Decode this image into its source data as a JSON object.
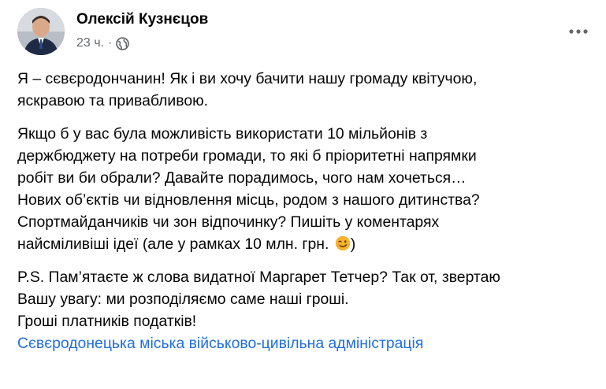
{
  "post": {
    "author": "Олексій Кузнєцов",
    "time": "23 ч.",
    "separator": "·",
    "privacy_icon": "globe-icon",
    "more_icon": "more-options-icon",
    "paragraphs": [
      {
        "lines": [
          "Я – сєвєродончанин! Як і ви хочу бачити нашу громаду квітучою,",
          "яскравою та привабливою."
        ]
      },
      {
        "lines": [
          "Якщо б у вас була можливість використати 10 мільйонів з",
          "держбюджету на потреби громади, то які б пріоритетні напрямки",
          "робіт ви би обрали? Давайте порадимось, чого нам хочеться…",
          "Нових об’єктів чи відновлення місць, родом з нашого дитинства?",
          "Спортмайданчиків чи зон відпочинку? Пишіть у коментарях"
        ],
        "last_line_before_emoji": "найсміливіші ідеї (але у рамках 10 млн. грн. ",
        "emoji": "winking-face-icon",
        "last_line_after_emoji": ")"
      },
      {
        "lines": [
          "P.S. Пам’ятаєте ж слова видатної Маргарет Тетчер? Так от, звертаю",
          "Вашу увагу: ми розподіляємо саме наші гроші.",
          "Гроші платників податків!"
        ],
        "link": "Сєвєродонецька міська військово-цивільна адміністрація"
      }
    ],
    "colors": {
      "text": "#050505",
      "secondary": "#65676b",
      "link": "#216fdb",
      "emoji": "#f7b32b"
    }
  }
}
